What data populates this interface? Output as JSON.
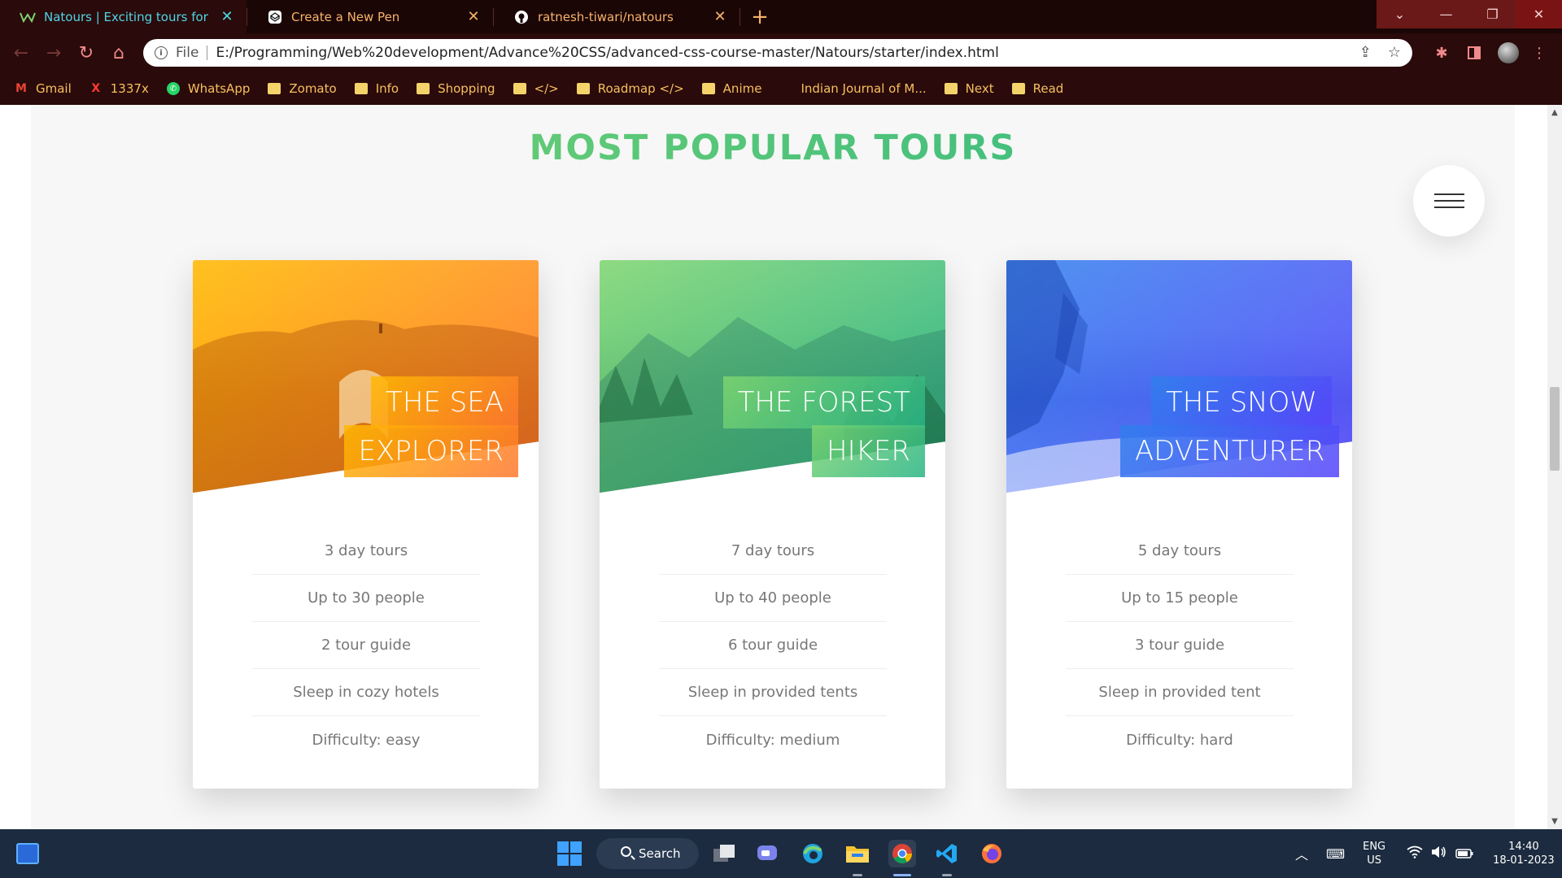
{
  "browser": {
    "tabs": [
      {
        "title": "Natours | Exciting tours for adven",
        "favicon": "natours-logo-icon",
        "active": true
      },
      {
        "title": "Create a New Pen",
        "favicon": "codepen-icon",
        "active": false
      },
      {
        "title": "ratnesh-tiwari/natours",
        "favicon": "github-icon",
        "active": false
      }
    ],
    "new_tab": "+",
    "window_controls": {
      "dropdown": "⌄",
      "minimize": "—",
      "restore": "❐",
      "close": "✕"
    },
    "address": {
      "scheme_label": "File",
      "url": "E:/Programming/Web%20development/Advance%20CSS/advanced-css-course-master/Natours/starter/index.html"
    },
    "bookmarks": [
      {
        "label": "Gmail",
        "icon": "gmail-icon"
      },
      {
        "label": "1337x",
        "icon": "x-icon"
      },
      {
        "label": "WhatsApp",
        "icon": "whatsapp-icon"
      },
      {
        "label": "Zomato",
        "icon": "folder-icon"
      },
      {
        "label": "Info",
        "icon": "folder-icon"
      },
      {
        "label": "Shopping",
        "icon": "folder-icon"
      },
      {
        "label": "</>",
        "icon": "folder-icon"
      },
      {
        "label": "Roadmap </>",
        "icon": "folder-icon"
      },
      {
        "label": "Anime",
        "icon": "folder-icon"
      },
      {
        "label": "Indian Journal of M...",
        "icon": "journal-icon"
      },
      {
        "label": "Next",
        "icon": "folder-icon"
      },
      {
        "label": "Read",
        "icon": "folder-icon"
      }
    ]
  },
  "page": {
    "section_title": "MOST POPULAR TOURS",
    "cards": [
      {
        "heading_line1": "THE SEA",
        "heading_line2": "EXPLORER",
        "details": [
          "3 day tours",
          "Up to 30 people",
          "2 tour guide",
          "Sleep in cozy hotels",
          "Difficulty: easy"
        ]
      },
      {
        "heading_line1": "THE FOREST",
        "heading_line2": "HIKER",
        "details": [
          "7 day tours",
          "Up to 40 people",
          "6 tour guide",
          "Sleep in provided tents",
          "Difficulty: medium"
        ]
      },
      {
        "heading_line1": "THE SNOW",
        "heading_line2": "ADVENTURER",
        "details": [
          "5 day tours",
          "Up to 15 people",
          "3 tour guide",
          "Sleep in provided tent",
          "Difficulty: hard"
        ]
      }
    ]
  },
  "taskbar": {
    "search_label": "Search",
    "language": "ENG",
    "region": "US",
    "time": "14:40",
    "date": "18-01-2023"
  },
  "colors": {
    "green_light": "#7ed56f",
    "green_dark": "#28b485",
    "orange_light": "#ffb900",
    "orange_dark": "#ff7730",
    "blue_light": "#2f80ed",
    "blue_dark": "#5643fa"
  }
}
